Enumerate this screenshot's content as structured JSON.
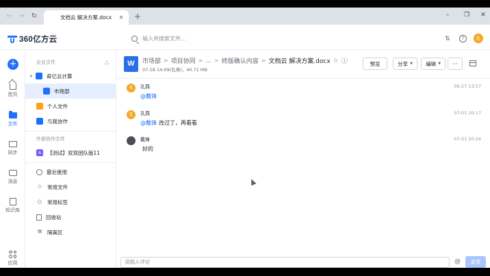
{
  "browser": {
    "tab_title": "文档云 解决方案.docx",
    "tab_close": "✕",
    "new_tab": "+",
    "back": "←",
    "forward": "→",
    "reload": "↻",
    "win_minimize": "–",
    "win_restore": "❐",
    "win_close": "✕"
  },
  "app": {
    "logo_text": "360亿方云",
    "search_placeholder": "输入并搜索文件...",
    "transfer_icon": "⇅",
    "help_icon": "?",
    "user_avatar": "孔"
  },
  "rail": {
    "add": "+",
    "items": [
      {
        "label": "首页",
        "icon": "home-icon"
      },
      {
        "label": "文件",
        "icon": "folder-icon"
      },
      {
        "label": "同步",
        "icon": "sync-icon"
      },
      {
        "label": "消息",
        "icon": "message-icon"
      },
      {
        "label": "知识库",
        "icon": "knowledge-base-icon"
      },
      {
        "label": "应用",
        "icon": "apps-icon"
      }
    ]
  },
  "tree": {
    "enterprise_title": "企业文件",
    "org_icon": "⛬",
    "company": "奇亿云计算",
    "department": "市场部",
    "personal": "个人文件",
    "shared_with_me": "与我协作",
    "external_title": "外部协作文件",
    "external_team": "【测试】双双团队版11",
    "recent": "最近使用",
    "favorites": "常用文件",
    "tags": "常用标签",
    "recycle": "回收站",
    "isolation": "隔离区",
    "caret": "▾",
    "team_icon_letter": "A"
  },
  "doc": {
    "icon_letter": "W",
    "breadcrumb": [
      "市场部",
      "项目协同",
      "...",
      "终版确认内容"
    ],
    "separator": ">",
    "file_name": "文档云 解决方案.docx",
    "star_icon": "☆",
    "info_icon": "ⓘ",
    "meta": "07-18 14:09(孔燕)，40.71 MB",
    "preview": "预览",
    "share": "分享",
    "edit": "编辑",
    "more": "···"
  },
  "comments": [
    {
      "avatar": "孔",
      "name": "孔燕",
      "mention": "@戴锋",
      "text": "",
      "time": "06-27 13:57"
    },
    {
      "avatar": "孔",
      "name": "孔燕",
      "mention": "@戴锋",
      "text": "改过了，再看看",
      "time": "07-01 20:17"
    },
    {
      "avatar": "",
      "name": "戴锋",
      "mention": "",
      "text": "好的",
      "time": "07-01 20:24"
    }
  ],
  "input": {
    "placeholder": "请输入评论",
    "at": "@",
    "send": "发表"
  },
  "colors": {
    "accent": "#1e6fff",
    "word_blue": "#2b6fe8",
    "avatar_orange": "#f5a623",
    "send_disabled": "#a8c6ff"
  }
}
